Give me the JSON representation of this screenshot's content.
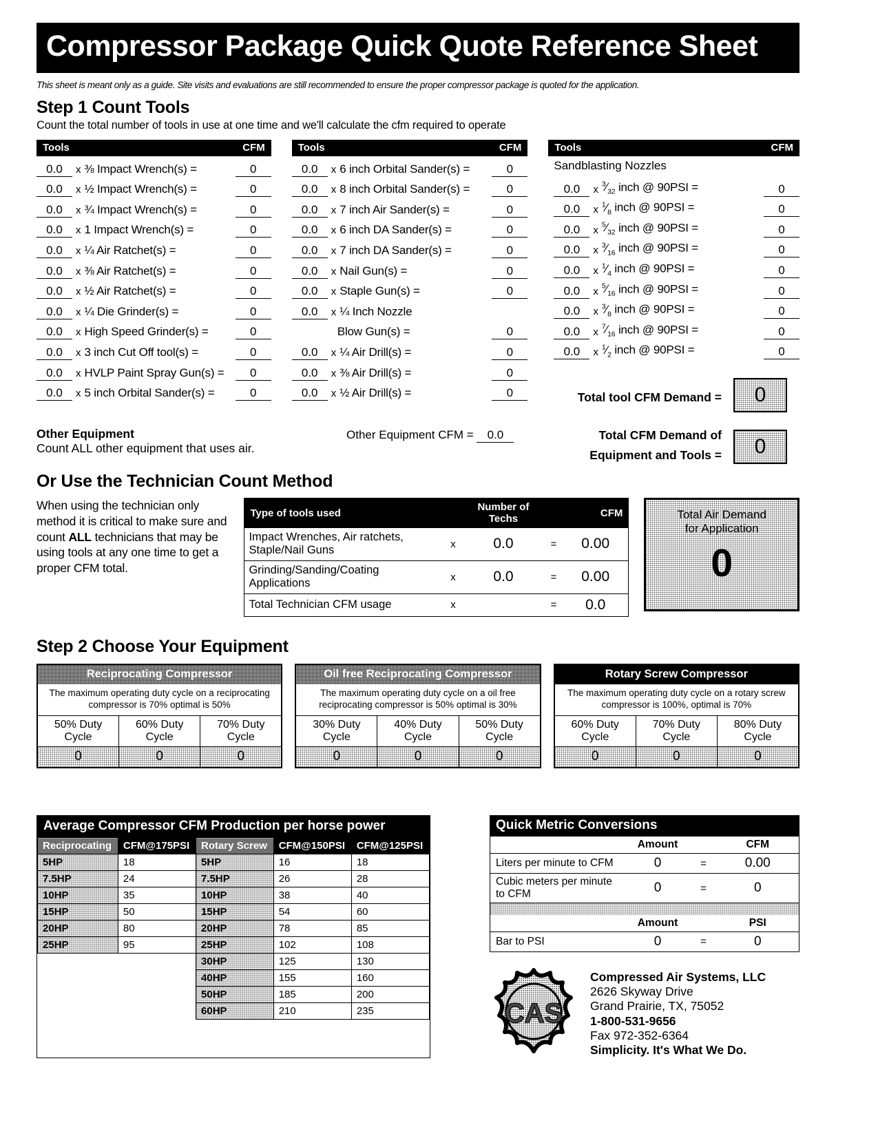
{
  "header": {
    "title": "Compressor Package Quick Quote Reference Sheet",
    "disclaimer": "This sheet is meant only as a guide. Site visits and evaluations are still recommended to ensure the proper compressor package is quoted for the application.",
    "step1_title": "Step 1 Count Tools",
    "step1_sub": "Count the total number of tools in use at one time and we'll calculate the cfm required to operate"
  },
  "tool_table": {
    "col_header_tools": "Tools",
    "col_header_cfm": "CFM",
    "multiply": "x",
    "equals": "=",
    "column1": [
      {
        "qty": "0.0",
        "label": "⅜ Impact Wrench(s) =",
        "cfm": "0"
      },
      {
        "qty": "0.0",
        "label": "½ Impact Wrench(s) =",
        "cfm": "0"
      },
      {
        "qty": "0.0",
        "label": "¾ Impact Wrench(s) =",
        "cfm": "0"
      },
      {
        "qty": "0.0",
        "label": "1 Impact Wrench(s) =",
        "cfm": "0"
      },
      {
        "qty": "0.0",
        "label": "¼ Air Ratchet(s) =",
        "cfm": "0"
      },
      {
        "qty": "0.0",
        "label": "⅜ Air Ratchet(s) =",
        "cfm": "0"
      },
      {
        "qty": "0.0",
        "label": "½ Air Ratchet(s) =",
        "cfm": "0"
      },
      {
        "qty": "0.0",
        "label": "¼ Die Grinder(s) =",
        "cfm": "0"
      },
      {
        "qty": "0.0",
        "label": "High Speed Grinder(s) =",
        "cfm": "0"
      },
      {
        "qty": "0.0",
        "label": "3 inch Cut Off tool(s) =",
        "cfm": "0"
      },
      {
        "qty": "0.0",
        "label": "HVLP Paint Spray Gun(s) =",
        "cfm": "0"
      },
      {
        "qty": "0.0",
        "label": "5 inch Orbital Sander(s) =",
        "cfm": "0"
      }
    ],
    "column2": [
      {
        "qty": "0.0",
        "label": "6 inch Orbital Sander(s) =",
        "cfm": "0"
      },
      {
        "qty": "0.0",
        "label": "8 inch Orbital Sander(s) =",
        "cfm": "0"
      },
      {
        "qty": "0.0",
        "label": "7 inch Air Sander(s) =",
        "cfm": "0"
      },
      {
        "qty": "0.0",
        "label": "6 inch DA Sander(s) =",
        "cfm": "0"
      },
      {
        "qty": "0.0",
        "label": "7 inch DA Sander(s) =",
        "cfm": "0"
      },
      {
        "qty": "0.0",
        "label": "Nail Gun(s) =",
        "cfm": "0"
      },
      {
        "qty": "0.0",
        "label": "Staple Gun(s) =",
        "cfm": "0"
      },
      {
        "qty": "0.0",
        "label": "¼ Inch Nozzle",
        "cfm": ""
      },
      {
        "qty": "",
        "label": "Blow Gun(s) =",
        "cfm": "0"
      },
      {
        "qty": "0.0",
        "label": "¼ Air Drill(s) =",
        "cfm": "0"
      },
      {
        "qty": "0.0",
        "label": "⅜ Air Drill(s) =",
        "cfm": "0"
      },
      {
        "qty": "0.0",
        "label": "½ Air Drill(s) =",
        "cfm": "0"
      }
    ],
    "column3_title": "Sandblasting Nozzles",
    "column3": [
      {
        "qty": "0.0",
        "label": "⅓₂ inch @ 90PSI =",
        "num": "3",
        "den": "32",
        "cfm": "0"
      },
      {
        "qty": "0.0",
        "label": "⅛ inch @ 90PSI =",
        "num": "1",
        "den": "8",
        "cfm": "0"
      },
      {
        "qty": "0.0",
        "label": "5/32 inch @ 90PSI =",
        "num": "5",
        "den": "32",
        "cfm": "0"
      },
      {
        "qty": "0.0",
        "label": "3/16 inch @ 90PSI =",
        "num": "3",
        "den": "16",
        "cfm": "0"
      },
      {
        "qty": "0.0",
        "label": "¼ inch @ 90PSI =",
        "num": "1",
        "den": "4",
        "cfm": "0"
      },
      {
        "qty": "0.0",
        "label": "5/16 inch @ 90PSI =",
        "num": "5",
        "den": "16",
        "cfm": "0"
      },
      {
        "qty": "0.0",
        "label": "⅜ inch @ 90PSI =",
        "num": "3",
        "den": "8",
        "cfm": "0"
      },
      {
        "qty": "0.0",
        "label": "7/16 inch @ 90PSI =",
        "num": "7",
        "den": "16",
        "cfm": "0"
      },
      {
        "qty": "0.0",
        "label": "½ inch @ 90PSI =",
        "num": "1",
        "den": "2",
        "cfm": "0"
      }
    ]
  },
  "totals": {
    "tool_demand_label": "Total tool CFM Demand =",
    "tool_demand_value": "0",
    "equip_tools_label_line1": "Total CFM Demand of",
    "equip_tools_label_line2": "Equipment and Tools =",
    "equip_tools_value": "0"
  },
  "other_equipment": {
    "heading": "Other Equipment",
    "text": "Count ALL other equipment that uses air.",
    "cfm_label": "Other Equipment CFM =",
    "cfm_value": "0.0"
  },
  "tech_method": {
    "heading": "Or Use the Technician Count Method",
    "note_part1": "When using the technician only method it is critical to make sure and count ",
    "note_bold": "ALL",
    "note_part2": " technicians that may be using tools at any one time to get a proper CFM total.",
    "headers": [
      "Type of tools used",
      "Number of Techs",
      "CFM"
    ],
    "multiply": "x",
    "equals": "=",
    "rows": [
      {
        "name": "Impact Wrenches, Air ratchets, Staple/Nail Guns",
        "techs": "0.0",
        "cfm": "0.00"
      },
      {
        "name": "Grinding/Sanding/Coating Applications",
        "techs": "0.0",
        "cfm": "0.00"
      },
      {
        "name": "Total Technician CFM usage",
        "techs": "",
        "cfm": "0.0"
      }
    ],
    "total_box": {
      "line1": "Total Air Demand",
      "line2": "for Application",
      "value": "0"
    }
  },
  "step2": {
    "title": "Step 2  Choose Your Equipment",
    "boxes": [
      {
        "name": "Reciprocating Compressor",
        "style": "screen",
        "desc": "The maximum operating duty cycle on a reciprocating compressor is 70% optimal is 50%",
        "cells": [
          "50% Duty Cycle",
          "60% Duty Cycle",
          "70% Duty Cycle"
        ],
        "values": [
          "0",
          "0",
          "0"
        ]
      },
      {
        "name": "Oil free Reciprocating Compressor",
        "style": "screen",
        "desc": "The maximum operating duty cycle on a oil free reciprocating compressor is 50% optimal is 30%",
        "cells": [
          "30% Duty Cycle",
          "40% Duty Cycle",
          "50% Duty Cycle"
        ],
        "values": [
          "0",
          "0",
          "0"
        ]
      },
      {
        "name": "Rotary Screw Compressor",
        "style": "solid",
        "desc": "The maximum operating duty cycle on a rotary screw compressor is 100%, optimal is 70%",
        "cells": [
          "60% Duty Cycle",
          "70% Duty Cycle",
          "80% Duty Cycle"
        ],
        "values": [
          "0",
          "0",
          "0"
        ]
      }
    ]
  },
  "avg_table": {
    "caption": "Average Compressor CFM Production per horse power",
    "headers": [
      "Reciprocating",
      "CFM@175PSI",
      "Rotary Screw",
      "CFM@150PSI",
      "CFM@125PSI"
    ],
    "rows": [
      [
        "5HP",
        "18",
        "5HP",
        "16",
        "18"
      ],
      [
        "7.5HP",
        "24",
        "7.5HP",
        "26",
        "28"
      ],
      [
        "10HP",
        "35",
        "10HP",
        "38",
        "40"
      ],
      [
        "15HP",
        "50",
        "15HP",
        "54",
        "60"
      ],
      [
        "20HP",
        "80",
        "20HP",
        "78",
        "85"
      ],
      [
        "25HP",
        "95",
        "25HP",
        "102",
        "108"
      ],
      [
        "",
        "",
        "30HP",
        "125",
        "130"
      ],
      [
        "",
        "",
        "40HP",
        "155",
        "160"
      ],
      [
        "",
        "",
        "50HP",
        "185",
        "200"
      ],
      [
        "",
        "",
        "60HP",
        "210",
        "235"
      ]
    ]
  },
  "metric": {
    "caption": "Quick Metric Conversions",
    "header_amount": "Amount",
    "header_cfm": "CFM",
    "header_psi": "PSI",
    "equals": "=",
    "rows": [
      {
        "label": "Liters per minute to CFM",
        "amount": "0",
        "value": "0.00"
      },
      {
        "label": "Cubic meters per minute to CFM",
        "amount": "0",
        "value": "0"
      }
    ],
    "psi_row": {
      "label": "Bar to PSI",
      "amount": "0",
      "value": "0"
    }
  },
  "company": {
    "logo_text": "CAS",
    "name": "Compressed Air Systems, LLC",
    "street": "2626 Skyway Drive",
    "citystate": "Grand Prairie, TX, 75052",
    "phone": "1-800-531-9656",
    "fax": "Fax 972-352-6364",
    "tagline": "Simplicity. It's What We Do."
  }
}
